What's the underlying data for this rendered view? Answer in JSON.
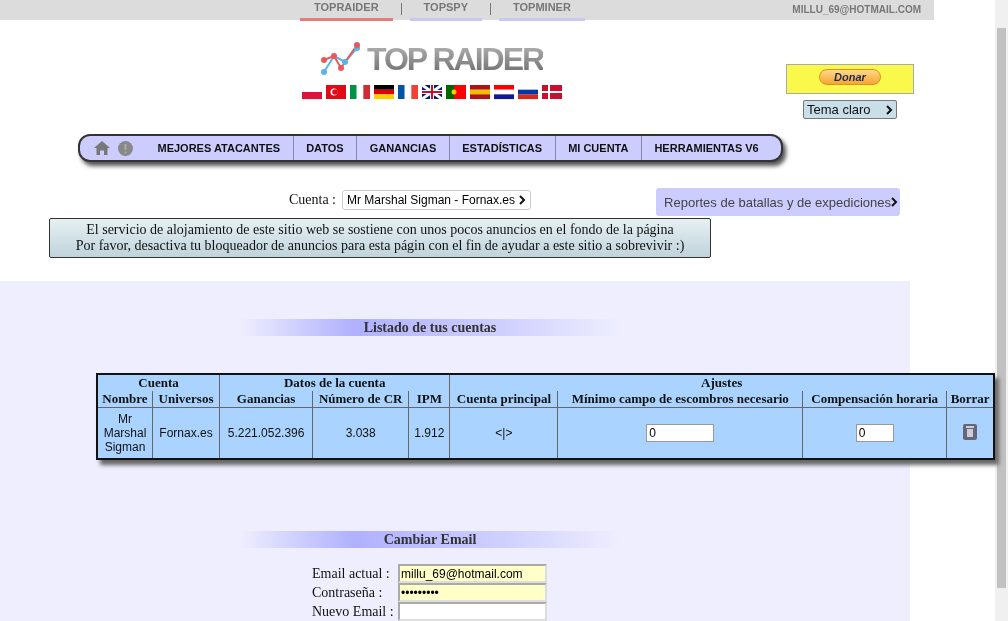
{
  "top_bar": {
    "tabs": [
      {
        "label": "TOPRAIDER",
        "selected": true
      },
      {
        "label": "TOPSPY",
        "selected": false
      },
      {
        "label": "TOPMINER",
        "selected": false
      }
    ],
    "user_email": "MILLU_69@HOTMAIL.COM"
  },
  "header": {
    "logo_text": "TOP RAIDER",
    "donate_button": "Donar",
    "theme_button": "Tema claro"
  },
  "nav": {
    "items": [
      "MEJORES ATACANTES",
      "DATOS",
      "GANANCIAS",
      "ESTADÍSTICAS",
      "MI CUENTA",
      "HERRAMIENTAS V6"
    ]
  },
  "account_selector": {
    "label": "Cuenta :",
    "value": "Mr Marshal Sigman - Fornax.es"
  },
  "reports_button": "Reportes de batallas y de expediciones",
  "notice": [
    "El servicio de alojamiento de este sitio web se sostiene con unos pocos anuncios en el fondo de la página",
    "Por favor, desactiva tu bloqueador de anuncios para esta págin con el fin de ayudar a este sitio a sobrevivir :)"
  ],
  "accounts_section": {
    "title": "Listado de tus cuentas",
    "group_headers": [
      {
        "label": "Cuenta",
        "columns": [
          "Nombre",
          "Universos"
        ]
      },
      {
        "label": "Datos de la cuenta",
        "columns": [
          "Ganancias",
          "Número de CR",
          "IPM"
        ]
      },
      {
        "label": "Ajustes",
        "columns": [
          "Cuenta principal",
          "Mínimo campo de escombros necesario",
          "Compensación horaria",
          "Borrar"
        ]
      }
    ],
    "rows": [
      {
        "cells": [
          {
            "kind": "text",
            "value": "Mr Marshal Sigman"
          },
          {
            "kind": "text",
            "value": "Fornax.es"
          },
          {
            "kind": "text",
            "value": "5.221.052.396"
          },
          {
            "kind": "text",
            "value": "3.038"
          },
          {
            "kind": "text",
            "value": "1.912"
          },
          {
            "kind": "text",
            "value": "<|>"
          },
          {
            "kind": "input",
            "value": "0"
          },
          {
            "kind": "input",
            "value": "0"
          },
          {
            "kind": "delete"
          }
        ]
      }
    ]
  },
  "email_section": {
    "title": "Cambiar Email",
    "fields": [
      {
        "label": "Email actual :",
        "value": "millu_69@hotmail.com",
        "filled": true
      },
      {
        "label": "Contraseña :",
        "value": "•••••••••",
        "filled": true
      },
      {
        "label": "Nuevo Email :",
        "filled": false
      }
    ]
  }
}
